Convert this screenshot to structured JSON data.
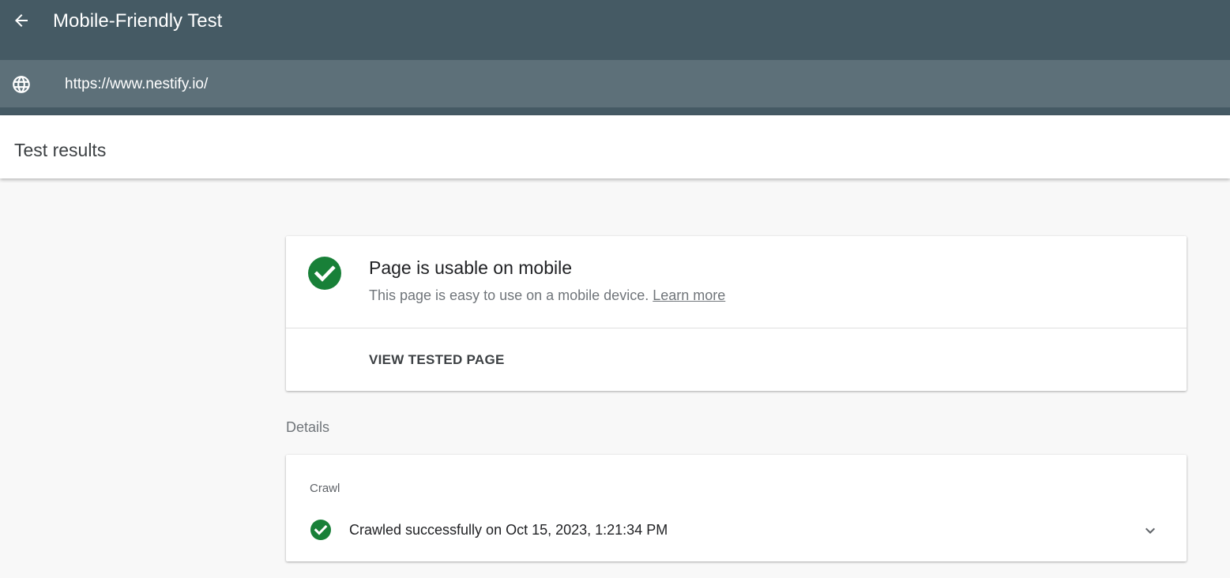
{
  "header": {
    "title": "Mobile-Friendly Test",
    "back_icon": "arrow-back-icon"
  },
  "url_bar": {
    "icon": "globe-icon",
    "value": "https://www.nestify.io/"
  },
  "results": {
    "title": "Test results"
  },
  "summary": {
    "icon": "check-circle-icon",
    "status_color": "#188038",
    "title": "Page is usable on mobile",
    "description": "This page is easy to use on a mobile device.",
    "learn_more": "Learn more",
    "view_button": "VIEW TESTED PAGE"
  },
  "details": {
    "label": "Details",
    "crawl": {
      "heading": "Crawl",
      "icon": "check-circle-icon",
      "status": "Crawled successfully on Oct 15, 2023, 1:21:34 PM",
      "expand_icon": "chevron-down-icon"
    }
  },
  "colors": {
    "topbar": "#455a64",
    "urlbar": "#5d7079",
    "success": "#188038"
  }
}
